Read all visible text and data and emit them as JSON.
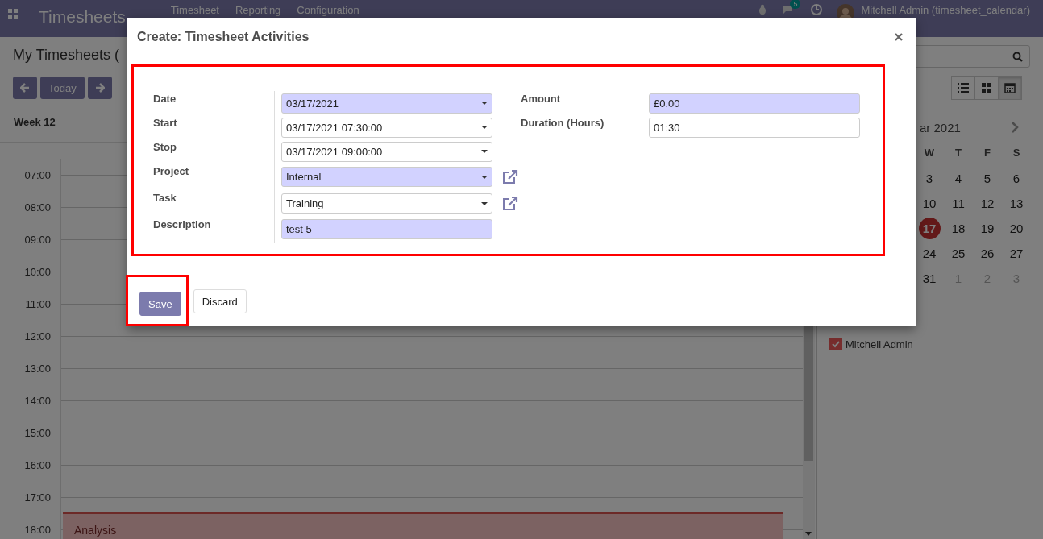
{
  "navbar": {
    "app_title": "Timesheets",
    "menu": [
      "Timesheet",
      "Reporting",
      "Configuration"
    ],
    "messages_badge": "5",
    "user": "Mitchell Admin (timesheet_calendar)"
  },
  "control_panel": {
    "title": "My Timesheets (",
    "buttons": [
      {
        "kind": "prev"
      },
      {
        "kind": "text",
        "label": "Today"
      },
      {
        "kind": "next"
      }
    ],
    "views": [
      {
        "kind": "list",
        "selected": false
      },
      {
        "kind": "kanban",
        "selected": false
      },
      {
        "kind": "calendar",
        "selected": true
      }
    ]
  },
  "calendar": {
    "week_label": "Week 12",
    "hours": [
      "07:00",
      "08:00",
      "09:00",
      "10:00",
      "11:00",
      "12:00",
      "13:00",
      "14:00",
      "15:00",
      "16:00",
      "17:00",
      "18:00"
    ],
    "events": [
      {
        "title": "Analysis"
      }
    ]
  },
  "sidebar": {
    "month_label": "ar 2021",
    "weekdays": [
      "W",
      "T",
      "F",
      "S"
    ],
    "weeks": [
      [
        {
          "day": "3",
          "other_month": false,
          "selected": false
        },
        {
          "day": "4",
          "other_month": false,
          "selected": false
        },
        {
          "day": "5",
          "other_month": false,
          "selected": false
        },
        {
          "day": "6",
          "other_month": false,
          "selected": false
        }
      ],
      [
        {
          "day": "10",
          "other_month": false,
          "selected": false
        },
        {
          "day": "11",
          "other_month": false,
          "selected": false
        },
        {
          "day": "12",
          "other_month": false,
          "selected": false
        },
        {
          "day": "13",
          "other_month": false,
          "selected": false
        }
      ],
      [
        {
          "day": "17",
          "other_month": false,
          "selected": true
        },
        {
          "day": "18",
          "other_month": false,
          "selected": false
        },
        {
          "day": "19",
          "other_month": false,
          "selected": false
        },
        {
          "day": "20",
          "other_month": false,
          "selected": false
        }
      ],
      [
        {
          "day": "24",
          "other_month": false,
          "selected": false
        },
        {
          "day": "25",
          "other_month": false,
          "selected": false
        },
        {
          "day": "26",
          "other_month": false,
          "selected": false
        },
        {
          "day": "27",
          "other_month": false,
          "selected": false
        }
      ],
      [
        {
          "day": "31",
          "other_month": false,
          "selected": false
        },
        {
          "day": "1",
          "other_month": true,
          "selected": false
        },
        {
          "day": "2",
          "other_month": true,
          "selected": false
        },
        {
          "day": "3",
          "other_month": true,
          "selected": false
        }
      ]
    ],
    "filters": [
      {
        "label": "Mitchell Admin",
        "checked": true
      }
    ]
  },
  "dialog": {
    "title": "Create: Timesheet Activities",
    "highlighted": true,
    "fields_left": [
      {
        "label": "Date",
        "value": "03/17/2021",
        "kind": "select",
        "required": true,
        "link": false
      },
      {
        "label": "Start",
        "value": "03/17/2021 07:30:00",
        "kind": "select",
        "required": false,
        "link": false
      },
      {
        "label": "Stop",
        "value": "03/17/2021 09:00:00",
        "kind": "select",
        "required": false,
        "link": false
      },
      {
        "label": "Project",
        "value": "Internal",
        "kind": "select",
        "required": true,
        "link": true
      },
      {
        "label": "Task",
        "value": "Training",
        "kind": "select",
        "required": false,
        "link": true
      },
      {
        "label": "Description",
        "value": "test 5",
        "kind": "text",
        "required": true,
        "link": false
      }
    ],
    "fields_right": [
      {
        "label": "Amount",
        "value": "£0.00",
        "kind": "text",
        "required": true,
        "link": false
      },
      {
        "label": "Duration (Hours)",
        "value": "01:30",
        "kind": "text",
        "required": false,
        "link": false
      }
    ],
    "buttons": [
      {
        "label": "Save",
        "kind": "primary",
        "highlighted": true
      },
      {
        "label": "Discard",
        "kind": "secondary",
        "highlighted": false
      }
    ]
  }
}
